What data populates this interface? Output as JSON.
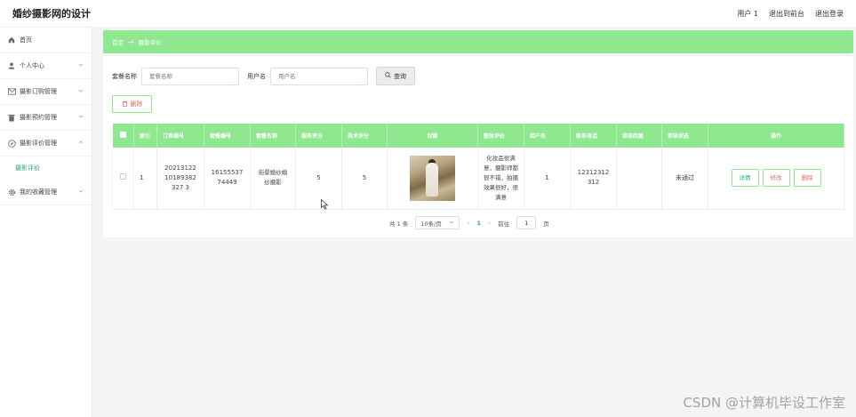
{
  "header": {
    "title": "婚纱摄影网的设计",
    "user": "用户 1",
    "back_to_front": "退出到前台",
    "logout": "退出登录"
  },
  "sidebar": {
    "items": [
      {
        "label": "首页",
        "icon": "home-icon"
      },
      {
        "label": "个人中心",
        "icon": "user-icon"
      },
      {
        "label": "摄影订购管理",
        "icon": "mail-icon"
      },
      {
        "label": "摄影预约管理",
        "icon": "trash-icon"
      },
      {
        "label": "摄影评价管理",
        "icon": "compass-icon"
      },
      {
        "label": "我的收藏管理",
        "icon": "gear-icon"
      }
    ],
    "sub_active": "摄影评价"
  },
  "breadcrumb": {
    "home": "首页",
    "current": "摄影评价"
  },
  "search": {
    "label1": "套餐名称",
    "placeholder1": "套餐名称",
    "label2": "用户名",
    "placeholder2": "用户名",
    "query_label": "查询"
  },
  "toolbar": {
    "delete_label": "删除"
  },
  "table": {
    "headers": [
      "索引",
      "订单编号",
      "套餐编号",
      "套餐名称",
      "服务评分",
      "技术评分",
      "封面",
      "整体评价",
      "用户名",
      "联系电话",
      "审核回复",
      "审核状态",
      "操作"
    ],
    "rows": [
      {
        "index": "1",
        "order_no": "2021312210189382327 3",
        "package_no": "1615553774449",
        "package_name": "街景婚纱婚纱摄影",
        "service_score": "5",
        "tech_score": "5",
        "review": "化妆品很满意，摄影师都很不错，拍摄效果很好，很满意",
        "username": "1",
        "phone": "12312312312",
        "reply": "",
        "status": "未通过",
        "op_detail": "详情",
        "op_edit": "修改",
        "op_delete": "删除"
      }
    ]
  },
  "pagination": {
    "total": "共 1 条",
    "page_size": "10条/页",
    "current": "1",
    "goto_label": "前往",
    "goto_value": "1",
    "page_suffix": "页"
  },
  "watermark": "CSDN @计算机毕设工作室"
}
